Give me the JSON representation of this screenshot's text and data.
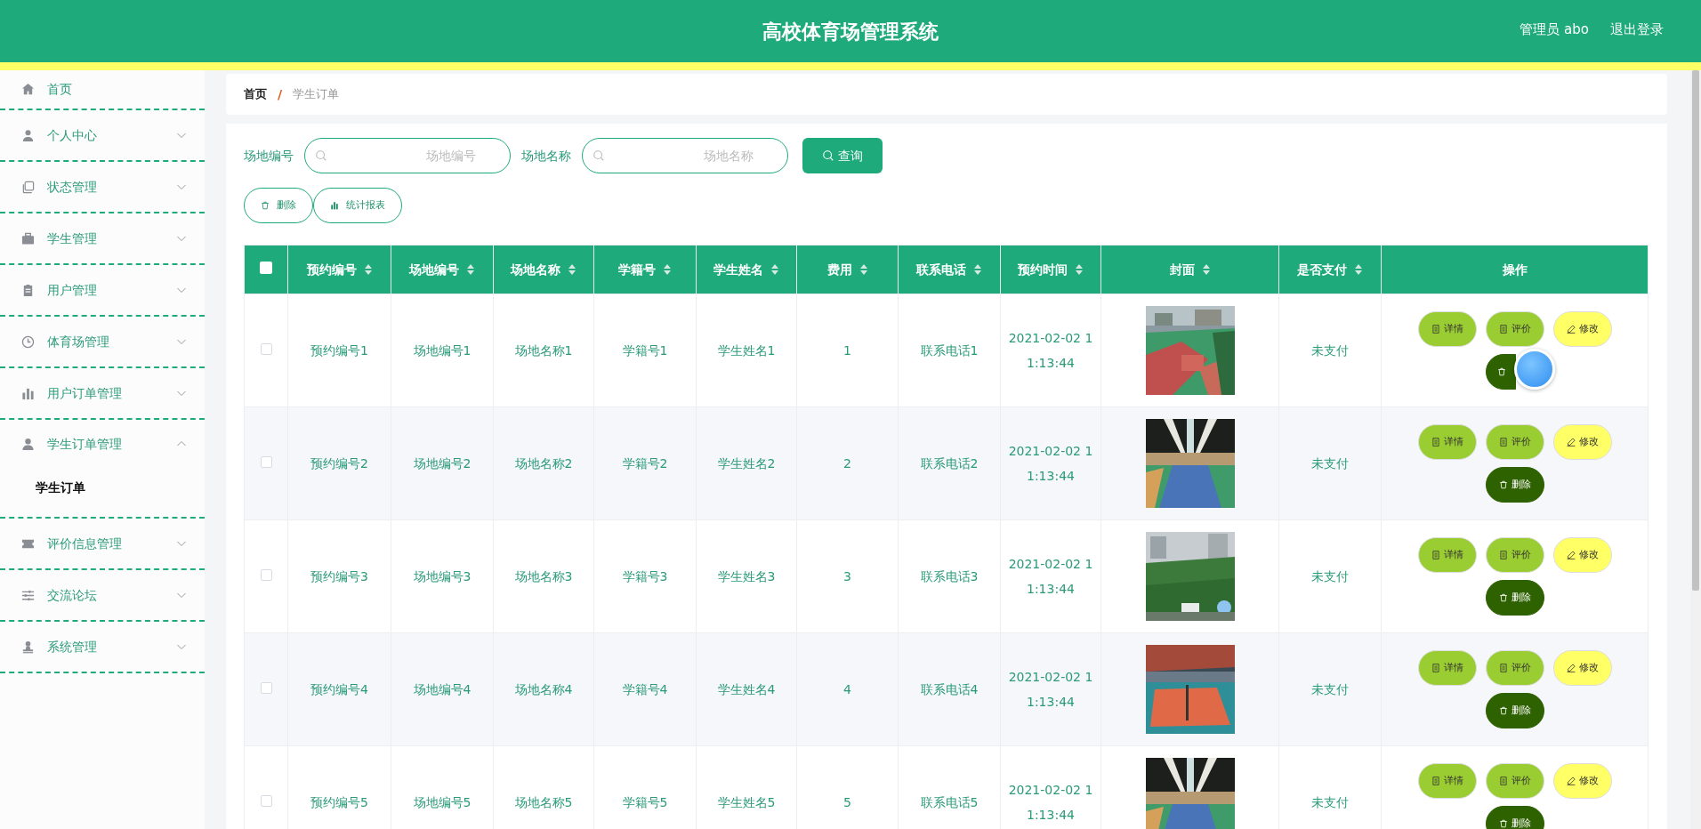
{
  "header": {
    "title": "高校体育场管理系统",
    "user": "管理员 abo",
    "logout": "退出登录"
  },
  "sidebar": {
    "items": [
      {
        "label": "首页"
      },
      {
        "label": "个人中心",
        "expanded": false
      },
      {
        "label": "状态管理",
        "expanded": false
      },
      {
        "label": "学生管理",
        "expanded": false
      },
      {
        "label": "用户管理",
        "expanded": false
      },
      {
        "label": "体育场管理",
        "expanded": false
      },
      {
        "label": "用户订单管理",
        "expanded": false
      },
      {
        "label": "学生订单管理",
        "expanded": true,
        "children": [
          {
            "label": "学生订单",
            "selected": true
          }
        ]
      },
      {
        "label": "评价信息管理",
        "expanded": false
      },
      {
        "label": "交流论坛",
        "expanded": false
      },
      {
        "label": "系统管理",
        "expanded": false
      }
    ]
  },
  "breadcrumb": {
    "items": [
      "首页",
      "学生订单"
    ],
    "separator": "/"
  },
  "search": {
    "fields": [
      {
        "label": "场地编号",
        "placeholder": "场地编号"
      },
      {
        "label": "场地名称",
        "placeholder": "场地名称"
      }
    ],
    "button": "查询"
  },
  "actions": [
    "删除",
    "统计报表"
  ],
  "table": {
    "header_checked": false,
    "columns": [
      {
        "label": "预约编号",
        "sortable": true
      },
      {
        "label": "场地编号",
        "sortable": true
      },
      {
        "label": "场地名称",
        "sortable": true
      },
      {
        "label": "学籍号",
        "sortable": true
      },
      {
        "label": "学生姓名",
        "sortable": true
      },
      {
        "label": "费用",
        "sortable": true
      },
      {
        "label": "联系电话",
        "sortable": true
      },
      {
        "label": "预约时间",
        "sortable": true
      },
      {
        "label": "封面",
        "sortable": true
      },
      {
        "label": "是否支付",
        "sortable": true
      },
      {
        "label": "操作",
        "sortable": false
      }
    ],
    "rows": [
      {
        "checked": false,
        "cells": [
          "预约编号1",
          "场地编号1",
          "场地名称1",
          "学籍号1",
          "学生姓名1",
          "1",
          "联系电话1",
          "2021-02-02 11:13:44"
        ],
        "cover": {
          "kind": "picture"
        },
        "paid": "未支付",
        "actions": [
          {
            "kind": "detail",
            "label": "详情"
          },
          {
            "kind": "review",
            "label": "评价"
          },
          {
            "kind": "edit",
            "label": "修改"
          },
          {
            "kind": "delete"
          }
        ]
      },
      {
        "checked": false,
        "cells": [
          "预约编号2",
          "场地编号2",
          "场地名称2",
          "学籍号2",
          "学生姓名2",
          "2",
          "联系电话2",
          "2021-02-02 11:13:44"
        ],
        "cover": {
          "kind": "picture"
        },
        "paid": "未支付",
        "actions": [
          {
            "kind": "detail",
            "label": "详情"
          },
          {
            "kind": "review",
            "label": "评价"
          },
          {
            "kind": "edit",
            "label": "修改"
          },
          {
            "kind": "delete",
            "label": "删除"
          }
        ]
      },
      {
        "checked": false,
        "cells": [
          "预约编号3",
          "场地编号3",
          "场地名称3",
          "学籍号3",
          "学生姓名3",
          "3",
          "联系电话3",
          "2021-02-02 11:13:44"
        ],
        "cover": {
          "kind": "picture"
        },
        "paid": "未支付",
        "actions": [
          {
            "kind": "detail",
            "label": "详情"
          },
          {
            "kind": "review",
            "label": "评价"
          },
          {
            "kind": "edit",
            "label": "修改"
          },
          {
            "kind": "delete",
            "label": "删除"
          }
        ]
      },
      {
        "checked": false,
        "cells": [
          "预约编号4",
          "场地编号4",
          "场地名称4",
          "学籍号4",
          "学生姓名4",
          "4",
          "联系电话4",
          "2021-02-02 11:13:44"
        ],
        "cover": {
          "kind": "picture"
        },
        "paid": "未支付",
        "actions": [
          {
            "kind": "detail",
            "label": "详情"
          },
          {
            "kind": "review",
            "label": "评价"
          },
          {
            "kind": "edit",
            "label": "修改"
          },
          {
            "kind": "delete",
            "label": "删除"
          }
        ]
      },
      {
        "checked": false,
        "cells": [
          "预约编号5",
          "场地编号5",
          "场地名称5",
          "学籍号5",
          "学生姓名5",
          "5",
          "联系电话5",
          "2021-02-02 11:13:44"
        ],
        "cover": {
          "kind": "picture"
        },
        "paid": "未支付",
        "actions": [
          {
            "kind": "detail",
            "label": "详情"
          },
          {
            "kind": "review",
            "label": "评价"
          },
          {
            "kind": "edit",
            "label": "修改"
          },
          {
            "kind": "delete",
            "label": "删除"
          }
        ]
      }
    ]
  }
}
